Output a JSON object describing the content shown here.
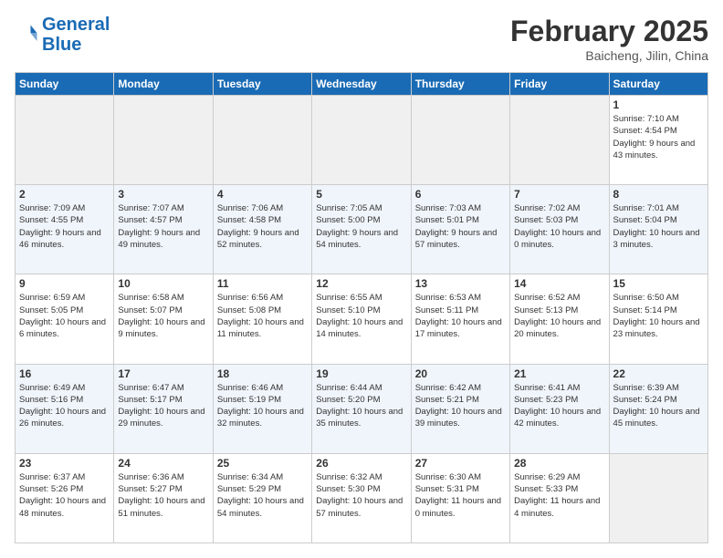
{
  "header": {
    "logo_line1": "General",
    "logo_line2": "Blue",
    "month": "February 2025",
    "location": "Baicheng, Jilin, China"
  },
  "weekdays": [
    "Sunday",
    "Monday",
    "Tuesday",
    "Wednesday",
    "Thursday",
    "Friday",
    "Saturday"
  ],
  "weeks": [
    [
      {
        "day": "",
        "info": ""
      },
      {
        "day": "",
        "info": ""
      },
      {
        "day": "",
        "info": ""
      },
      {
        "day": "",
        "info": ""
      },
      {
        "day": "",
        "info": ""
      },
      {
        "day": "",
        "info": ""
      },
      {
        "day": "1",
        "info": "Sunrise: 7:10 AM\nSunset: 4:54 PM\nDaylight: 9 hours and 43 minutes."
      }
    ],
    [
      {
        "day": "2",
        "info": "Sunrise: 7:09 AM\nSunset: 4:55 PM\nDaylight: 9 hours and 46 minutes."
      },
      {
        "day": "3",
        "info": "Sunrise: 7:07 AM\nSunset: 4:57 PM\nDaylight: 9 hours and 49 minutes."
      },
      {
        "day": "4",
        "info": "Sunrise: 7:06 AM\nSunset: 4:58 PM\nDaylight: 9 hours and 52 minutes."
      },
      {
        "day": "5",
        "info": "Sunrise: 7:05 AM\nSunset: 5:00 PM\nDaylight: 9 hours and 54 minutes."
      },
      {
        "day": "6",
        "info": "Sunrise: 7:03 AM\nSunset: 5:01 PM\nDaylight: 9 hours and 57 minutes."
      },
      {
        "day": "7",
        "info": "Sunrise: 7:02 AM\nSunset: 5:03 PM\nDaylight: 10 hours and 0 minutes."
      },
      {
        "day": "8",
        "info": "Sunrise: 7:01 AM\nSunset: 5:04 PM\nDaylight: 10 hours and 3 minutes."
      }
    ],
    [
      {
        "day": "9",
        "info": "Sunrise: 6:59 AM\nSunset: 5:05 PM\nDaylight: 10 hours and 6 minutes."
      },
      {
        "day": "10",
        "info": "Sunrise: 6:58 AM\nSunset: 5:07 PM\nDaylight: 10 hours and 9 minutes."
      },
      {
        "day": "11",
        "info": "Sunrise: 6:56 AM\nSunset: 5:08 PM\nDaylight: 10 hours and 11 minutes."
      },
      {
        "day": "12",
        "info": "Sunrise: 6:55 AM\nSunset: 5:10 PM\nDaylight: 10 hours and 14 minutes."
      },
      {
        "day": "13",
        "info": "Sunrise: 6:53 AM\nSunset: 5:11 PM\nDaylight: 10 hours and 17 minutes."
      },
      {
        "day": "14",
        "info": "Sunrise: 6:52 AM\nSunset: 5:13 PM\nDaylight: 10 hours and 20 minutes."
      },
      {
        "day": "15",
        "info": "Sunrise: 6:50 AM\nSunset: 5:14 PM\nDaylight: 10 hours and 23 minutes."
      }
    ],
    [
      {
        "day": "16",
        "info": "Sunrise: 6:49 AM\nSunset: 5:16 PM\nDaylight: 10 hours and 26 minutes."
      },
      {
        "day": "17",
        "info": "Sunrise: 6:47 AM\nSunset: 5:17 PM\nDaylight: 10 hours and 29 minutes."
      },
      {
        "day": "18",
        "info": "Sunrise: 6:46 AM\nSunset: 5:19 PM\nDaylight: 10 hours and 32 minutes."
      },
      {
        "day": "19",
        "info": "Sunrise: 6:44 AM\nSunset: 5:20 PM\nDaylight: 10 hours and 35 minutes."
      },
      {
        "day": "20",
        "info": "Sunrise: 6:42 AM\nSunset: 5:21 PM\nDaylight: 10 hours and 39 minutes."
      },
      {
        "day": "21",
        "info": "Sunrise: 6:41 AM\nSunset: 5:23 PM\nDaylight: 10 hours and 42 minutes."
      },
      {
        "day": "22",
        "info": "Sunrise: 6:39 AM\nSunset: 5:24 PM\nDaylight: 10 hours and 45 minutes."
      }
    ],
    [
      {
        "day": "23",
        "info": "Sunrise: 6:37 AM\nSunset: 5:26 PM\nDaylight: 10 hours and 48 minutes."
      },
      {
        "day": "24",
        "info": "Sunrise: 6:36 AM\nSunset: 5:27 PM\nDaylight: 10 hours and 51 minutes."
      },
      {
        "day": "25",
        "info": "Sunrise: 6:34 AM\nSunset: 5:29 PM\nDaylight: 10 hours and 54 minutes."
      },
      {
        "day": "26",
        "info": "Sunrise: 6:32 AM\nSunset: 5:30 PM\nDaylight: 10 hours and 57 minutes."
      },
      {
        "day": "27",
        "info": "Sunrise: 6:30 AM\nSunset: 5:31 PM\nDaylight: 11 hours and 0 minutes."
      },
      {
        "day": "28",
        "info": "Sunrise: 6:29 AM\nSunset: 5:33 PM\nDaylight: 11 hours and 4 minutes."
      },
      {
        "day": "",
        "info": ""
      }
    ]
  ]
}
